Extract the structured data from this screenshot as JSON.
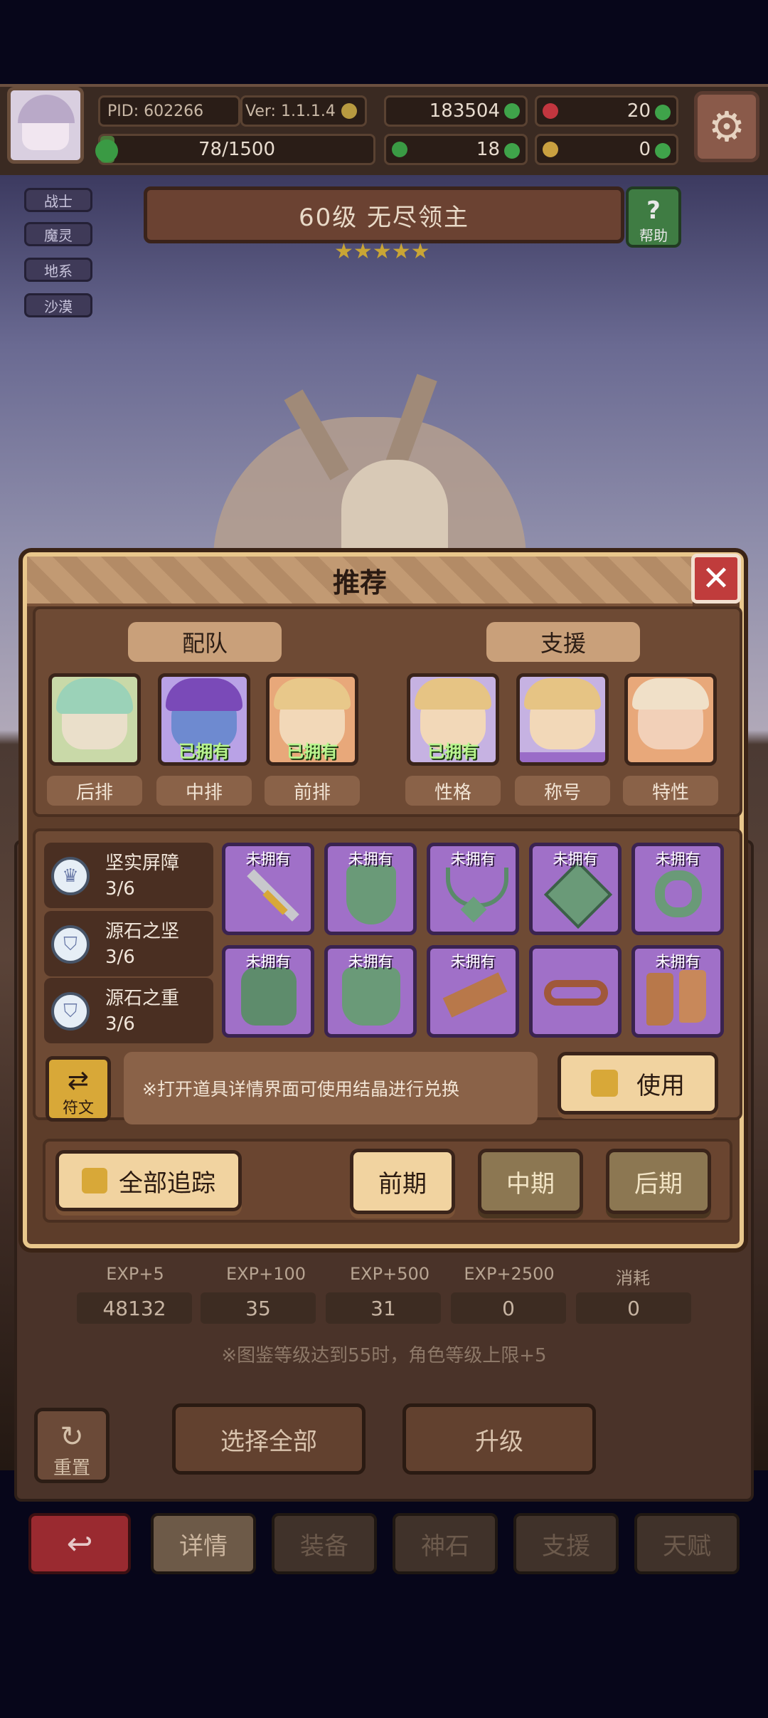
{
  "header": {
    "pid": "PID: 602266",
    "version": "Ver: 1.1.1.4",
    "gold": "183504",
    "gems": "20",
    "exp_progress": "78/1500",
    "exp_fraction": 0.052,
    "clover": "18",
    "keys": "0"
  },
  "side_tags": [
    "战士",
    "魔灵",
    "地系",
    "沙漠"
  ],
  "boss": {
    "title": "60级  无尽领主",
    "stars": 5,
    "help_label": "帮助"
  },
  "modal": {
    "title": "推荐",
    "close_label": "✕",
    "team_label": "配队",
    "support_label": "支援",
    "team": [
      {
        "role": "后排",
        "owned": ""
      },
      {
        "role": "中排",
        "owned": "已拥有"
      },
      {
        "role": "前排",
        "owned": "已拥有"
      }
    ],
    "support": [
      {
        "role": "性格",
        "owned": "已拥有"
      },
      {
        "role": "称号",
        "owned": ""
      },
      {
        "role": "特性",
        "owned": ""
      }
    ],
    "sets": [
      {
        "name": "坚实屏障",
        "count": "3/6"
      },
      {
        "name": "源石之坚",
        "count": "3/6"
      },
      {
        "name": "源石之重",
        "count": "3/6"
      }
    ],
    "items": [
      {
        "icon": "sword-icon",
        "status": "未拥有"
      },
      {
        "icon": "shield-icon",
        "status": "未拥有"
      },
      {
        "icon": "necklace-icon",
        "status": "未拥有"
      },
      {
        "icon": "gem-icon",
        "status": "未拥有"
      },
      {
        "icon": "ring-icon",
        "status": "未拥有"
      },
      {
        "icon": "armor-icon",
        "status": "未拥有"
      },
      {
        "icon": "chestplate-icon",
        "status": "未拥有"
      },
      {
        "icon": "bracer-icon",
        "status": "未拥有"
      },
      {
        "icon": "belt-icon",
        "status": ""
      },
      {
        "icon": "boots-icon",
        "status": "未拥有"
      }
    ],
    "rune_label": "符文",
    "hint": "※打开道具详情界面可使用结晶进行兑换",
    "use_label": "使用",
    "track_all_label": "全部追踪",
    "phases": [
      "前期",
      "中期",
      "后期"
    ]
  },
  "exp_row": {
    "labels": [
      "EXP+5",
      "EXP+100",
      "EXP+500",
      "EXP+2500",
      "消耗"
    ],
    "values": [
      "48132",
      "35",
      "31",
      "0",
      "0"
    ]
  },
  "note": "※图鉴等级达到55时，角色等级上限+5",
  "bottom_actions": {
    "reset": "重置",
    "select_all": "选择全部",
    "upgrade": "升级"
  },
  "tabs": [
    "详情",
    "装备",
    "神石",
    "支援",
    "天赋"
  ],
  "colors": {
    "owned_green": "#b8f48e",
    "close_red": "#c03c3c",
    "item_purple": "#a070c8"
  }
}
